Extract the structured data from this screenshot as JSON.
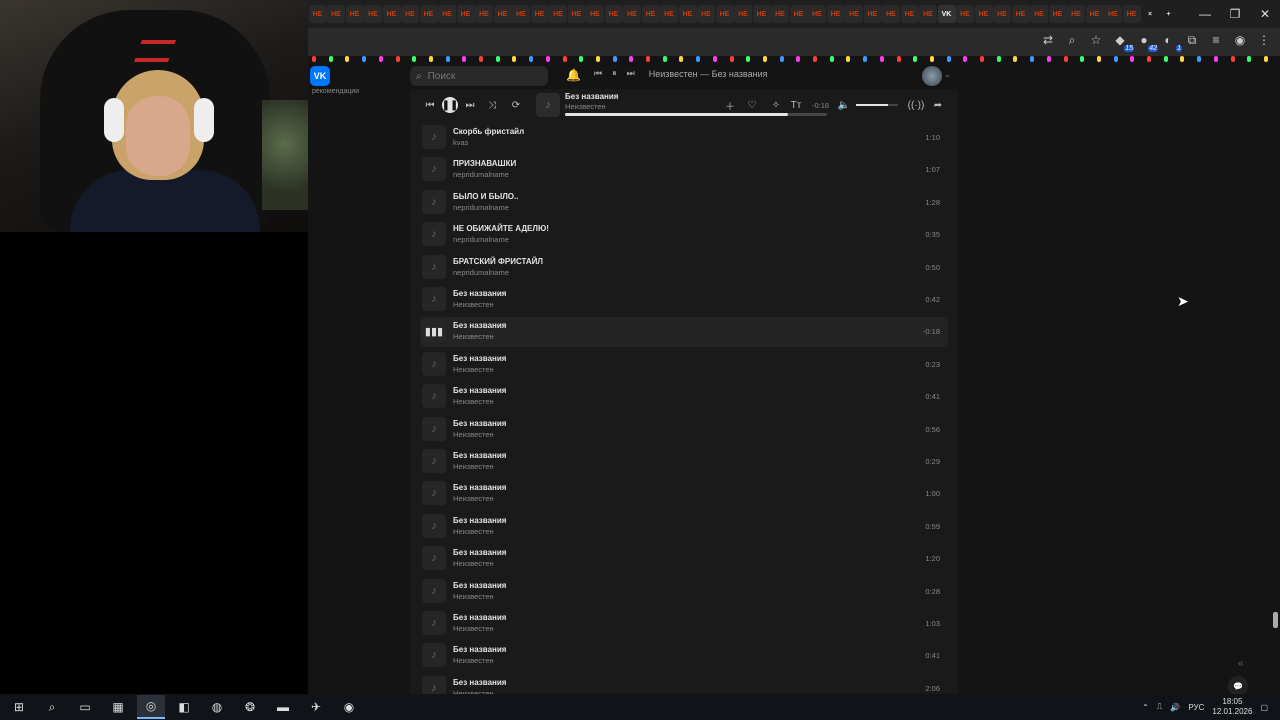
{
  "browser": {
    "tab_colors": [
      "#c73b0f",
      "#c73b0f",
      "#c73b0f",
      "#c73b0f",
      "#c73b0f",
      "#c73b0f",
      "#c73b0f",
      "#c73b0f",
      "#c73b0f",
      "#c73b0f",
      "#c73b0f",
      "#c73b0f",
      "#c73b0f",
      "#c73b0f",
      "#c73b0f",
      "#c73b0f",
      "#c73b0f",
      "#c73b0f",
      "#c73b0f",
      "#c73b0f",
      "#c73b0f",
      "#c73b0f",
      "#c73b0f",
      "#c73b0f",
      "#c73b0f",
      "#c73b0f",
      "#c73b0f",
      "#c73b0f",
      "#c73b0f",
      "#c73b0f",
      "#c73b0f",
      "#c73b0f",
      "#c73b0f",
      "#c73b0f",
      "#c73b0f",
      "#c73b0f",
      "#c73b0f",
      "#c73b0f",
      "#c73b0f",
      "#c73b0f",
      "#c73b0f",
      "#c73b0f",
      "#c73b0f",
      "#c73b0f"
    ],
    "tab_label": "НЕ",
    "vk_tab_label": "VK",
    "close_tab": "×",
    "new_tab": "+",
    "window_controls": {
      "minimize": "—",
      "restore": "❐",
      "close": "✕"
    },
    "extension_badges": {
      "ext1": "15",
      "ext2": "42",
      "ext3": "1"
    }
  },
  "vk": {
    "logo": "VK",
    "search_placeholder": "Поиск",
    "mini_player_title": "Неизвестен — Без названия",
    "recommendations_label": "рекомендации",
    "now_playing": {
      "title": "Без названия",
      "artist": "Неизвестен",
      "time": "-0:18",
      "progress": 0.85,
      "volume": 0.75
    },
    "tracks": [
      {
        "title": "Скорбь фристайл",
        "artist": "kvas",
        "duration": "1:10"
      },
      {
        "title": "ПРИЗНАВАШКИ",
        "artist": "nepridumalname",
        "duration": "1:07"
      },
      {
        "title": "БЫЛО И БЫЛО..",
        "artist": "nepridumalname",
        "duration": "1:28"
      },
      {
        "title": "НЕ ОБИЖАЙТЕ АДЕЛЮ!",
        "artist": "nepridumalname",
        "duration": "0:35"
      },
      {
        "title": "БРАТСКИЙ ФРИСТАЙЛ",
        "artist": "nepridumalname",
        "duration": "0:50"
      },
      {
        "title": "Без названия",
        "artist": "Неизвестен",
        "duration": "0:42"
      },
      {
        "title": "Без названия",
        "artist": "Неизвестен",
        "duration": "-0:18"
      },
      {
        "title": "Без названия",
        "artist": "Неизвестен",
        "duration": "0:23"
      },
      {
        "title": "Без названия",
        "artist": "Неизвестен",
        "duration": "0:41"
      },
      {
        "title": "Без названия",
        "artist": "Неизвестен",
        "duration": "0:56"
      },
      {
        "title": "Без названия",
        "artist": "Неизвестен",
        "duration": "0:29"
      },
      {
        "title": "Без названия",
        "artist": "Неизвестен",
        "duration": "1:00"
      },
      {
        "title": "Без названия",
        "artist": "Неизвестен",
        "duration": "0:59"
      },
      {
        "title": "Без названия",
        "artist": "Неизвестен",
        "duration": "1:20"
      },
      {
        "title": "Без названия",
        "artist": "Неизвестен",
        "duration": "0:28"
      },
      {
        "title": "Без названия",
        "artist": "Неизвестен",
        "duration": "1:03"
      },
      {
        "title": "Без названия",
        "artist": "Неизвестен",
        "duration": "0:41"
      },
      {
        "title": "Без названия",
        "artist": "Неизвестен",
        "duration": "2:06"
      }
    ],
    "active_track_index": 6
  },
  "taskbar": {
    "language": "РУС",
    "time": "18:05",
    "date": "12.01.2026"
  }
}
